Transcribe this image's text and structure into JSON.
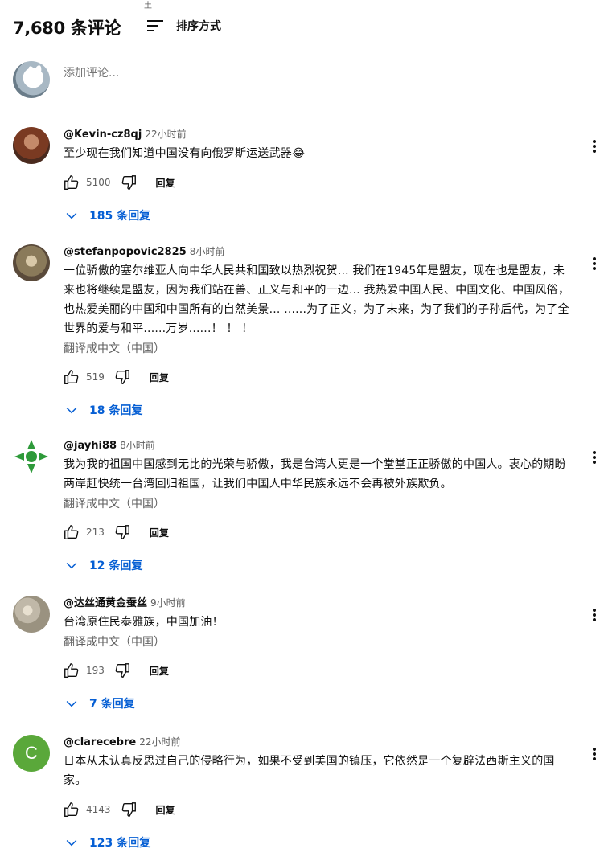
{
  "header": {
    "comment_count": "7,680 条评论",
    "sort_label": "排序方式",
    "stray_glyph": "土"
  },
  "new_comment": {
    "placeholder": "添加评论..."
  },
  "comments": [
    {
      "author": "@Kevin-cz8qj",
      "time": "22小时前",
      "text": "至少现在我们知道中国没有向俄罗斯运送武器😂",
      "translate": "",
      "likes": "5100",
      "reply_label": "回复",
      "replies": "185 条回复",
      "avatar_color": "#8a4a2a"
    },
    {
      "author": "@stefanpopovic2825",
      "time": "8小时前",
      "text": "一位骄傲的塞尔维亚人向中华人民共和国致以热烈祝贺... 我们在1945年是盟友，现在也是盟友，未来也将继续是盟友，因为我们站在善、正义与和平的一边... 我热爱中国人民、中国文化、中国风俗，也热爱美丽的中国和中国所有的自然美景... ......为了正义，为了未来，为了我们的子孙后代，为了全世界的爱与和平......万岁......！ ！ ！",
      "translate": "翻译成中文（中国）",
      "likes": "519",
      "reply_label": "回复",
      "replies": "18 条回复",
      "avatar_color": "#9a8a6a"
    },
    {
      "author": "@jayhi88",
      "time": "8小时前",
      "text": "我为我的祖国中国感到无比的光荣与骄傲，我是台湾人更是一个堂堂正正骄傲的中国人。衷心的期盼两岸赶快统一台湾回归祖国，让我们中国人中华民族永远不会再被外族欺负。",
      "translate": "翻译成中文（中国）",
      "likes": "213",
      "reply_label": "回复",
      "replies": "12 条回复",
      "avatar_color": "#2e9a3a"
    },
    {
      "author": "@达丝通黄金蚕丝",
      "time": "9小时前",
      "text": "台湾原住民泰雅族，中国加油！",
      "translate": "翻译成中文（中国）",
      "likes": "193",
      "reply_label": "回复",
      "replies": "7 条回复",
      "avatar_color": "#b8b0a0"
    },
    {
      "author": "@clarecebre",
      "time": "22小时前",
      "text": "日本从未认真反思过自己的侵略行为，如果不受到美国的镇压，它依然是一个复辟法西斯主义的国家。",
      "translate": "",
      "likes": "4143",
      "reply_label": "回复",
      "replies": "123 条回复",
      "avatar_color": "#5aa83a",
      "avatar_letter": "C"
    }
  ]
}
